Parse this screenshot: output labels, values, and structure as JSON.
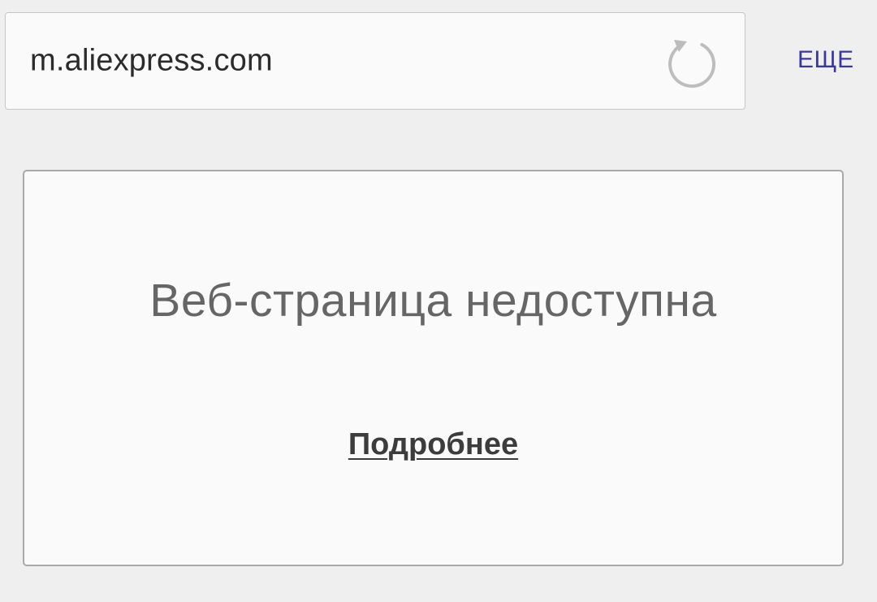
{
  "address_bar": {
    "url": "m.aliexpress.com",
    "reload_icon": "reload-icon"
  },
  "header": {
    "more_label": "ЕЩЕ"
  },
  "error_card": {
    "title": "Веб-страница недоступна",
    "details_link": "Подробнее"
  },
  "colors": {
    "background": "#efefef",
    "card": "#fafafa",
    "more_link": "#3a3a94",
    "title_text": "#666666",
    "reload_icon": "#bdbdbd"
  }
}
